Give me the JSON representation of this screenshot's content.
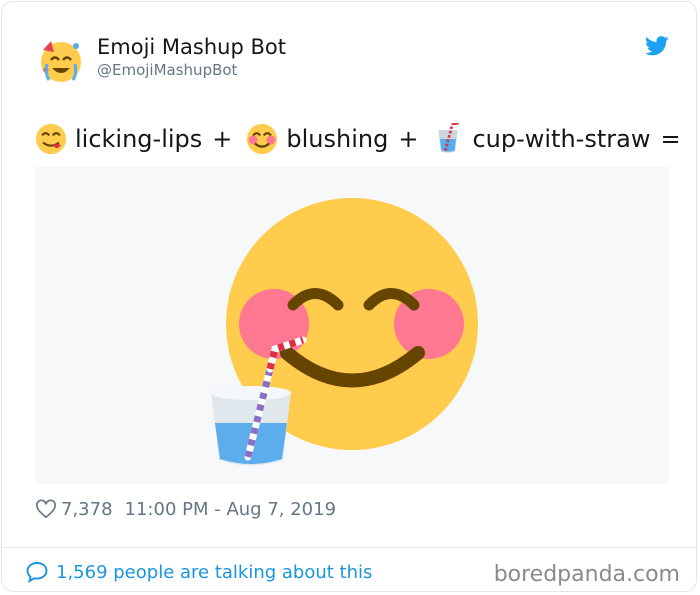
{
  "author": {
    "name": "Emoji Mashup Bot",
    "handle": "@EmojiMashupBot"
  },
  "tweet": {
    "parts": [
      {
        "icon": "face-savoring-food-icon",
        "label": "licking-lips"
      },
      {
        "icon": "smiling-face-with-smiling-eyes-icon",
        "label": "blushing"
      },
      {
        "icon": "cup-with-straw-icon",
        "label": "cup-with-straw"
      }
    ],
    "plus": "+",
    "equals": "=",
    "media_icon": "blushing-face-with-cup-and-straw-mashup-icon"
  },
  "meta": {
    "likes": "7,378",
    "timestamp": "11:00 PM - Aug 7, 2019"
  },
  "footer": {
    "talking": "1,569 people are talking about this"
  },
  "watermark": "boredpanda.com",
  "colors": {
    "twitter_blue": "#1da1f2",
    "link_blue": "#1b95e0",
    "emoji_yellow": "#ffcc4d",
    "blush_pink": "#ff7892",
    "mouth_brown": "#664500"
  }
}
